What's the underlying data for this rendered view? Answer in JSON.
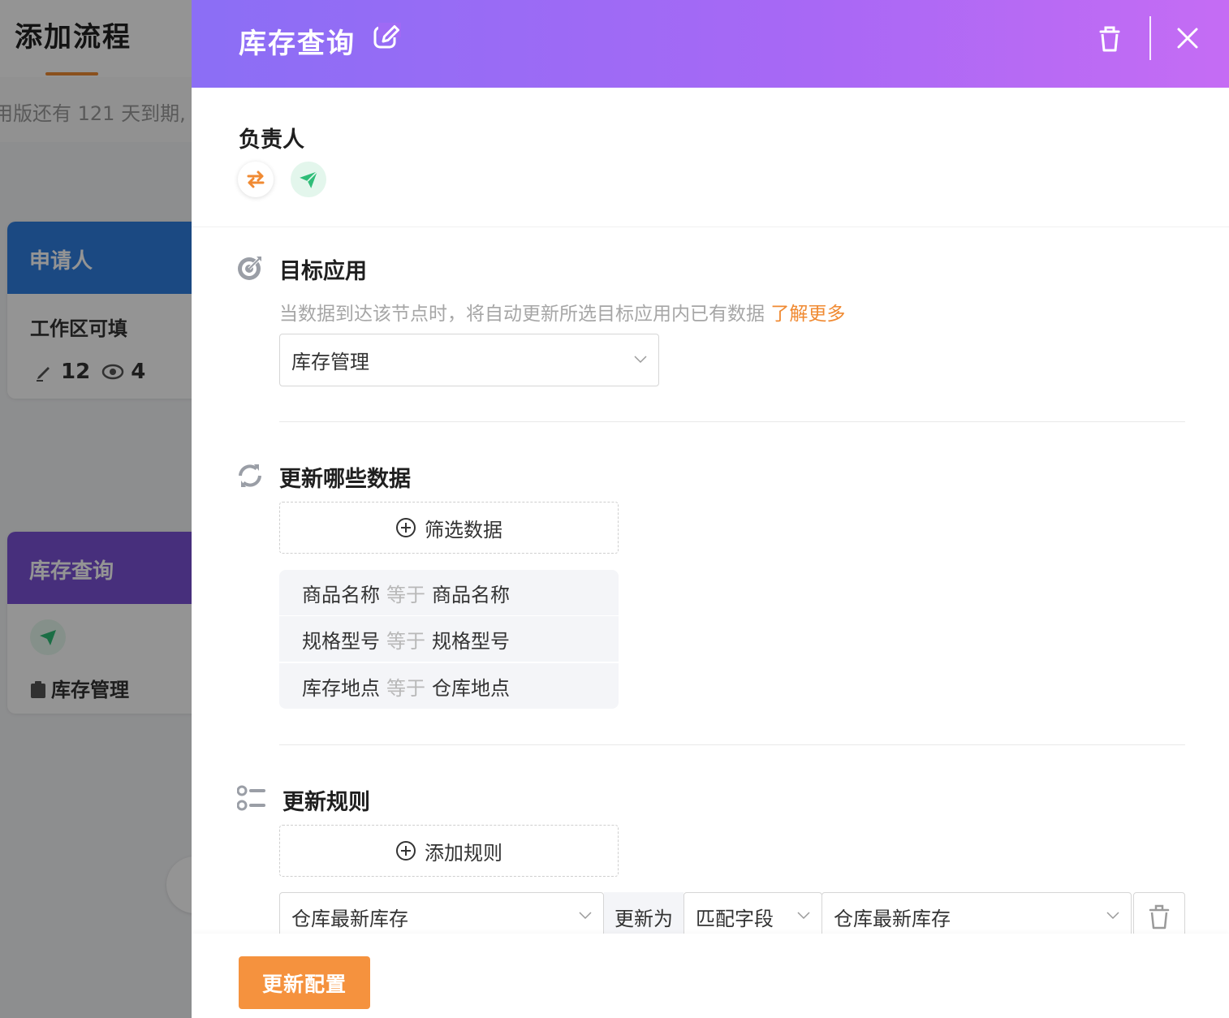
{
  "background": {
    "page_title": "添加流程",
    "banner_text": "用版还有 121 天到期,",
    "cards": [
      {
        "title": "申请人",
        "line": "工作区可填",
        "edit_count": "12",
        "view_count": "4"
      },
      {
        "title": "库存查询",
        "line": "库存管理"
      }
    ]
  },
  "drawer": {
    "title": "库存查询",
    "owner": {
      "label": "负责人"
    },
    "target_app": {
      "label": "目标应用",
      "description": "当数据到达该节点时，将自动更新所选目标应用内已有数据",
      "learn_more": "了解更多",
      "selected": "库存管理"
    },
    "which_data": {
      "label": "更新哪些数据",
      "filter_button": "筛选数据",
      "conditions": [
        {
          "field": "商品名称",
          "op": "等于",
          "value": "商品名称"
        },
        {
          "field": "规格型号",
          "op": "等于",
          "value": "规格型号"
        },
        {
          "field": "库存地点",
          "op": "等于",
          "value": "仓库地点"
        }
      ]
    },
    "rules": {
      "label": "更新规则",
      "add_button": "添加规则",
      "items": [
        {
          "target_field": "仓库最新库存",
          "update_to": "更新为",
          "mode": "匹配字段",
          "source_field": "仓库最新库存"
        }
      ]
    },
    "footer": {
      "submit_label": "更新配置"
    }
  },
  "colors": {
    "header_gradient_start": "#8b6ef5",
    "header_gradient_end": "#c56cf4",
    "accent_orange": "#f5923e",
    "link_orange": "#f08a32",
    "send_green": "#2fbd78"
  },
  "icons": [
    "edit-icon",
    "trash-icon",
    "close-icon",
    "swap-icon",
    "send-icon",
    "target-icon",
    "refresh-icon",
    "rules-list-icon",
    "plus-circle-icon",
    "chevron-down-icon"
  ]
}
